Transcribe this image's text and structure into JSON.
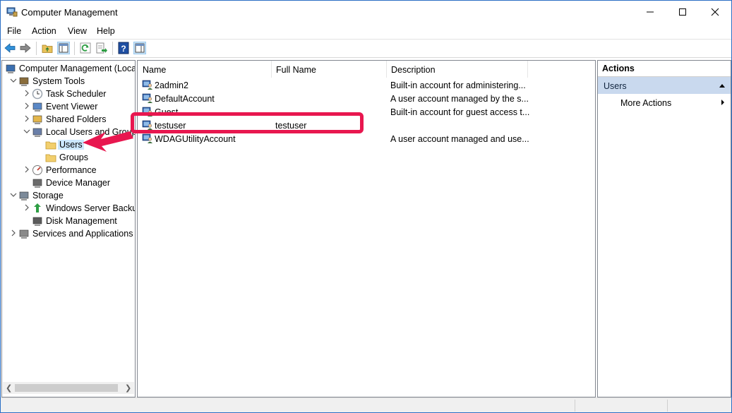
{
  "window": {
    "title": "Computer Management"
  },
  "menu": [
    "File",
    "Action",
    "View",
    "Help"
  ],
  "tree": [
    {
      "label": "Computer Management (Local",
      "indent": 0,
      "icon": "computer-management-icon"
    },
    {
      "label": "System Tools",
      "indent": 1,
      "icon": "system-tools-icon",
      "expanded": true
    },
    {
      "label": "Task Scheduler",
      "indent": 2,
      "icon": "clock-icon"
    },
    {
      "label": "Event Viewer",
      "indent": 2,
      "icon": "event-viewer-icon"
    },
    {
      "label": "Shared Folders",
      "indent": 2,
      "icon": "shared-folder-icon"
    },
    {
      "label": "Local Users and Groups",
      "indent": 2,
      "icon": "users-groups-icon",
      "expanded": true
    },
    {
      "label": "Users",
      "indent": 3,
      "icon": "folder-icon",
      "selected": true
    },
    {
      "label": "Groups",
      "indent": 3,
      "icon": "folder-icon"
    },
    {
      "label": "Performance",
      "indent": 2,
      "icon": "performance-icon"
    },
    {
      "label": "Device Manager",
      "indent": 2,
      "icon": "device-manager-icon"
    },
    {
      "label": "Storage",
      "indent": 1,
      "icon": "storage-icon",
      "expanded": true
    },
    {
      "label": "Windows Server Backup",
      "indent": 2,
      "icon": "backup-icon"
    },
    {
      "label": "Disk Management",
      "indent": 2,
      "icon": "disk-icon"
    },
    {
      "label": "Services and Applications",
      "indent": 1,
      "icon": "services-icon"
    }
  ],
  "list": {
    "columns": [
      "Name",
      "Full Name",
      "Description"
    ],
    "rows": [
      {
        "name": "2admin2",
        "full_name": "",
        "description": "Built-in account for administering..."
      },
      {
        "name": "DefaultAccount",
        "full_name": "",
        "description": "A user account managed by the s..."
      },
      {
        "name": "Guest",
        "full_name": "",
        "description": "Built-in account for guest access t..."
      },
      {
        "name": "testuser",
        "full_name": "testuser",
        "description": ""
      },
      {
        "name": "WDAGUtilityAccount",
        "full_name": "",
        "description": "A user account managed and use..."
      }
    ]
  },
  "actions": {
    "header": "Actions",
    "section": "Users",
    "items": [
      "More Actions"
    ]
  },
  "annotation": {
    "color": "#e8174f"
  }
}
